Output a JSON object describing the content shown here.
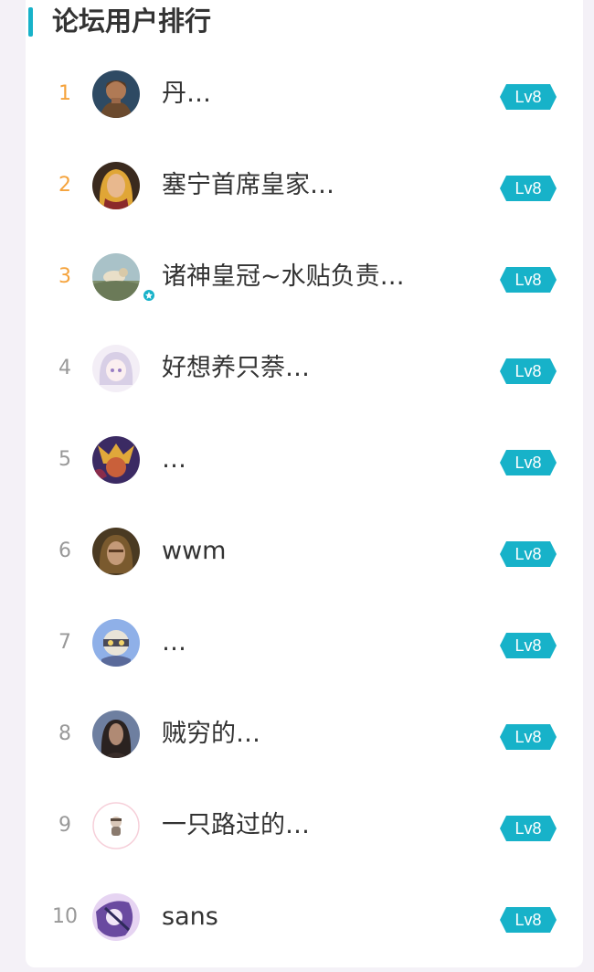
{
  "widget": {
    "title": "论坛用户排行"
  },
  "ranking": [
    {
      "rank": "1",
      "name": "丹…",
      "level": "Lv8",
      "avatar_icon": "knight-avatar-icon"
    },
    {
      "rank": "2",
      "name": "塞宁首席皇家…",
      "level": "Lv8",
      "avatar_icon": "blonde-woman-avatar-icon"
    },
    {
      "rank": "3",
      "name": "诸神皇冠~水贴负责…",
      "level": "Lv8",
      "avatar_icon": "landscape-avatar-icon",
      "verified": true
    },
    {
      "rank": "4",
      "name": "好想养只萘…",
      "level": "Lv8",
      "avatar_icon": "anime-girl-avatar-icon"
    },
    {
      "rank": "5",
      "name": "…",
      "level": "Lv8",
      "avatar_icon": "monkey-king-avatar-icon"
    },
    {
      "rank": "6",
      "name": "wwm",
      "level": "Lv8",
      "avatar_icon": "warrior-avatar-icon"
    },
    {
      "rank": "7",
      "name": "…",
      "level": "Lv8",
      "avatar_icon": "armored-knight-avatar-icon"
    },
    {
      "rank": "8",
      "name": "贼穷的…",
      "level": "Lv8",
      "avatar_icon": "dark-hero-avatar-icon"
    },
    {
      "rank": "9",
      "name": "一只路过的…",
      "level": "Lv8",
      "avatar_icon": "small-character-avatar-icon"
    },
    {
      "rank": "10",
      "name": "sans",
      "level": "Lv8",
      "avatar_icon": "art-avatar-icon"
    }
  ],
  "colors": {
    "accent": "#17b2c9",
    "top_rank": "#f5a33c",
    "rank": "#999999",
    "text": "#333333",
    "page_background": "#f4f1f7"
  }
}
